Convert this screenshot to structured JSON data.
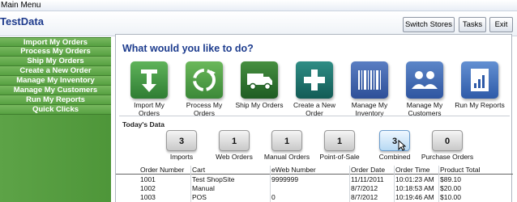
{
  "window": {
    "title": "Main Menu"
  },
  "header": {
    "app_title": "TestData",
    "buttons": {
      "switch_stores": "Switch Stores",
      "tasks": "Tasks",
      "exit": "Exit"
    }
  },
  "sidebar": {
    "items": [
      {
        "label": "Import My Orders"
      },
      {
        "label": "Process My Orders"
      },
      {
        "label": "Ship My Orders"
      },
      {
        "label": "Create a New Order"
      },
      {
        "label": "Manage My Inventory"
      },
      {
        "label": "Manage My Customers"
      },
      {
        "label": "Run My Reports"
      },
      {
        "label": "Quick Clicks"
      }
    ]
  },
  "main": {
    "question": "What would you like to do?",
    "tiles": [
      {
        "label": "Import My Orders",
        "icon": "import-icon",
        "color": "#3f8f3c"
      },
      {
        "label": "Process My Orders",
        "icon": "process-icon",
        "color": "#4f9a41"
      },
      {
        "label": "Ship My Orders",
        "icon": "truck-icon",
        "color": "#2e6e2f"
      },
      {
        "label": "Create a New Order",
        "icon": "plus-icon",
        "color": "#1d6f6a"
      },
      {
        "label": "Manage My Inventory",
        "icon": "barcode-icon",
        "color": "#3b5ea8"
      },
      {
        "label": "Manage My Customers",
        "icon": "customers-icon",
        "color": "#3d68b0"
      },
      {
        "label": "Run My Reports",
        "icon": "reports-icon",
        "color": "#3f6db6"
      }
    ],
    "today_heading": "Today's Data",
    "counts": [
      {
        "value": "3",
        "label": "Imports"
      },
      {
        "value": "1",
        "label": "Web Orders"
      },
      {
        "value": "1",
        "label": "Manual Orders"
      },
      {
        "value": "1",
        "label": "Point-of-Sale"
      },
      {
        "value": "3",
        "label": "Combined"
      },
      {
        "value": "0",
        "label": "Purchase Orders"
      }
    ],
    "table": {
      "columns": [
        "Order Number",
        "Cart",
        "eWeb Number",
        "Order Date",
        "Order Time",
        "Product Total"
      ],
      "rows": [
        [
          "1001",
          "Test ShopSite",
          "9999999",
          "11/11/2011",
          "10:01:23 AM",
          "$89.10"
        ],
        [
          "1002",
          "Manual",
          "",
          "8/7/2012",
          "10:18:53 AM",
          "$20.00"
        ],
        [
          "1003",
          "POS",
          "0",
          "8/7/2012",
          "10:19:46 AM",
          "$10.00"
        ]
      ]
    }
  }
}
